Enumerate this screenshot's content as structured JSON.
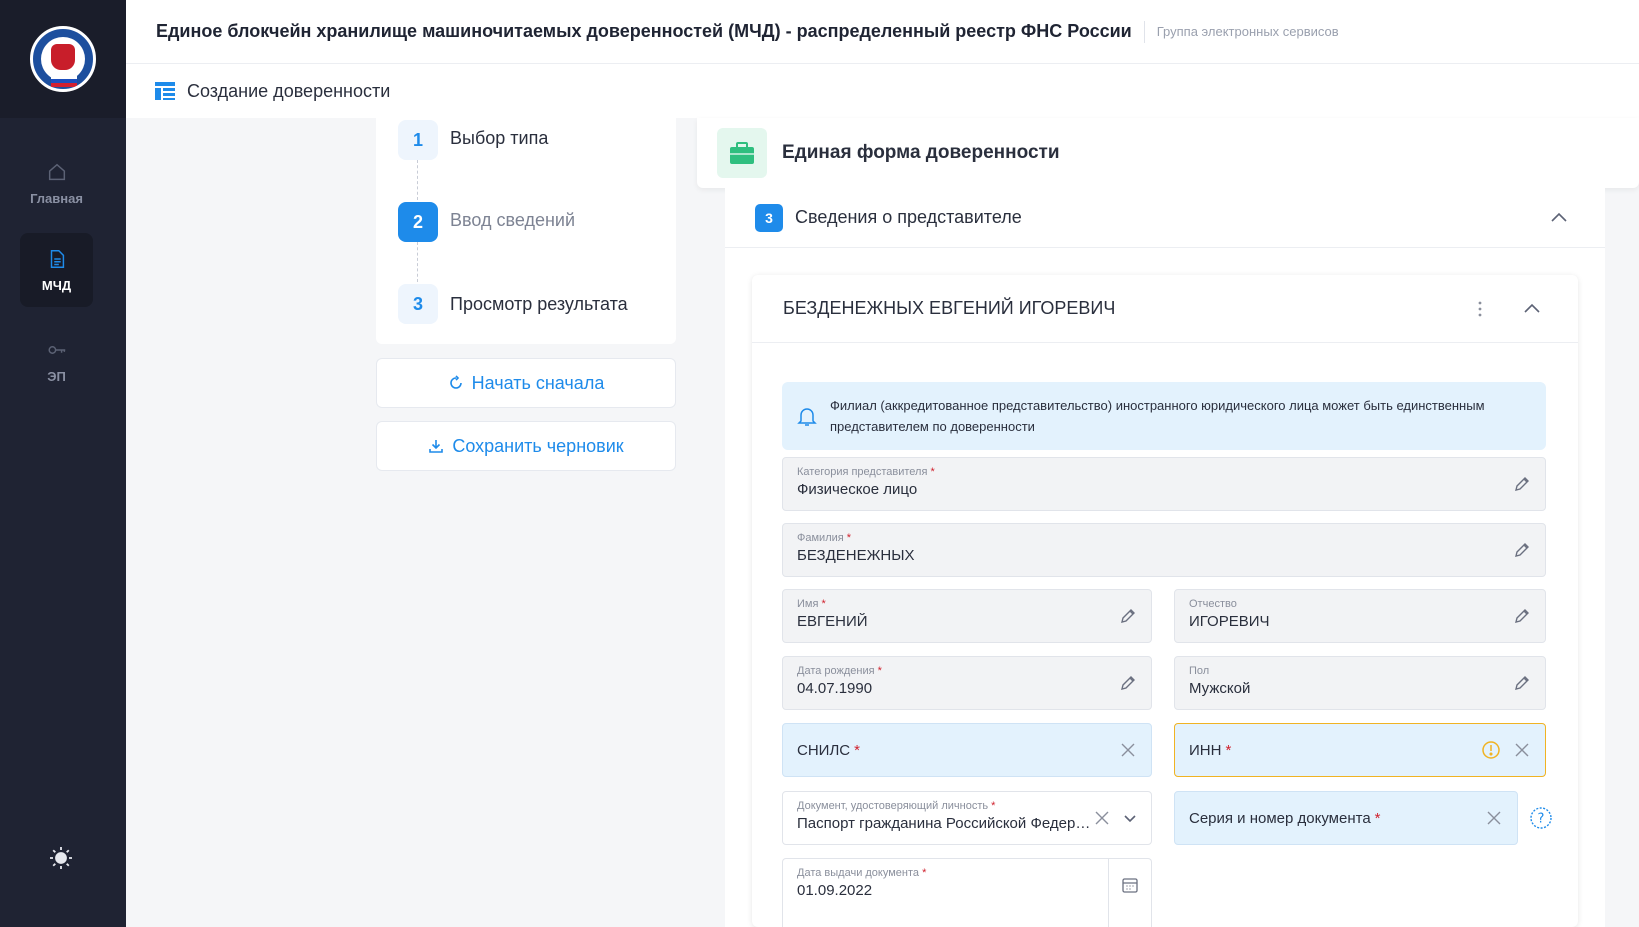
{
  "header": {
    "title": "Единое блокчейн хранилище машиночитаемых доверенностей (МЧД) - распределенный реестр ФНС России",
    "group": "Группа электронных сервисов"
  },
  "subheader": {
    "title": "Создание доверенности"
  },
  "sidebar": {
    "items": [
      {
        "label": "Главная",
        "icon": "home-icon"
      },
      {
        "label": "МЧД",
        "icon": "document-icon",
        "active": true
      },
      {
        "label": "ЭП",
        "icon": "key-icon"
      }
    ]
  },
  "steps": [
    {
      "number": "1",
      "label": "Выбор типа"
    },
    {
      "number": "2",
      "label": "Ввод сведений",
      "active": true
    },
    {
      "number": "3",
      "label": "Просмотр результата"
    }
  ],
  "actions": {
    "restart": "Начать сначала",
    "save_draft": "Сохранить черновик"
  },
  "form": {
    "title": "Единая форма доверенности",
    "section_number": "3",
    "section_title": "Сведения о представителе",
    "person_name": "БЕЗДЕНЕЖНЫХ ЕВГЕНИЙ ИГОРЕВИЧ",
    "notice": "Филиал (аккредитованное представительство) иностранного юридического лица может быть единственным представителем по доверенности",
    "fields": {
      "category": {
        "label": "Категория представителя",
        "value": "Физическое лицо"
      },
      "surname": {
        "label": "Фамилия",
        "value": "БЕЗДЕНЕЖНЫХ"
      },
      "name": {
        "label": "Имя",
        "value": "ЕВГЕНИЙ"
      },
      "patronymic": {
        "label": "Отчество",
        "value": "ИГОРЕВИЧ"
      },
      "birth_date": {
        "label": "Дата рождения",
        "value": "04.07.1990"
      },
      "gender": {
        "label": "Пол",
        "value": "Мужской"
      },
      "snils": {
        "label": "СНИЛС"
      },
      "inn": {
        "label": "ИНН"
      },
      "id_doc": {
        "label": "Документ, удостоверяющий личность",
        "value": "Паспорт гражданина Российской Федерации"
      },
      "series_number": {
        "label": "Серия и номер документа"
      },
      "issue_date": {
        "label": "Дата выдачи документа",
        "value": "01.09.2022"
      }
    },
    "required_mark": "*"
  },
  "colors": {
    "accent": "#1e8bea",
    "sidebar": "#1f2333",
    "warning": "#f0b323",
    "required": "#d0222e"
  }
}
